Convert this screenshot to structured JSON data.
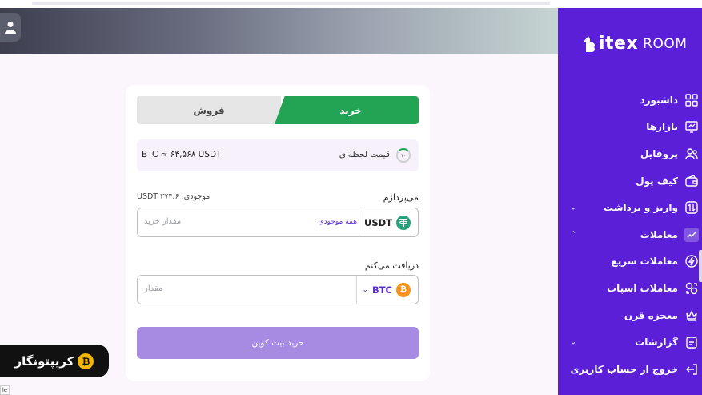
{
  "brand": {
    "logo_main": "itex",
    "logo_sub": "ROOM"
  },
  "sidebar": {
    "items": [
      {
        "label": "داشبورد",
        "icon": "dashboard-grid-icon",
        "has_chevron": false
      },
      {
        "label": "بازارها",
        "icon": "market-chart-icon",
        "has_chevron": false
      },
      {
        "label": "پروفایل",
        "icon": "profile-users-icon",
        "has_chevron": false
      },
      {
        "label": "کیف پول",
        "icon": "wallet-icon",
        "has_chevron": false
      },
      {
        "label": "واریز و برداشت",
        "icon": "deposit-withdraw-icon",
        "has_chevron": true,
        "chevron": "⌄"
      },
      {
        "label": "معاملات",
        "icon": "trades-chart-icon",
        "has_chevron": true,
        "chevron": "⌃"
      },
      {
        "label": "معاملات سریع",
        "icon": "quick-trade-icon",
        "has_chevron": false
      },
      {
        "label": "معاملات اسپات",
        "icon": "spot-trade-icon",
        "has_chevron": false
      },
      {
        "label": "معجزه قرن",
        "icon": "crown-icon",
        "has_chevron": false
      },
      {
        "label": "گزارشات",
        "icon": "reports-icon",
        "has_chevron": true,
        "chevron": "⌄"
      },
      {
        "label": "خروج از حساب کاربری",
        "icon": "logout-icon",
        "has_chevron": false
      }
    ]
  },
  "trade": {
    "tab_sell": "فروش",
    "tab_buy": "خرید",
    "price_label": "قیمت لحظه‌ای",
    "price_value": "BTC ≈ ۶۴,۵۶۸ USDT",
    "timer_text": "۱۰",
    "pay_label": "می‌پردازم",
    "balance_label": "موجودی:",
    "balance_value": "USDT ۳۷۴.۶",
    "pay_coin": "USDT",
    "all_balance": "همه موجودی",
    "pay_placeholder": "مقدار خرید",
    "recv_label": "دریافت می‌کنم",
    "recv_coin": "BTC",
    "recv_placeholder": "مقدار",
    "submit": "خرید بیت کوین"
  },
  "watermark": {
    "text": "کریپتونگار"
  },
  "corner": {
    "text": "le"
  },
  "colors": {
    "sidebar": "#5a1fd6",
    "buy_green": "#22a454",
    "submit_disabled": "#a78be3",
    "accent_purple": "#5a2bd0"
  }
}
